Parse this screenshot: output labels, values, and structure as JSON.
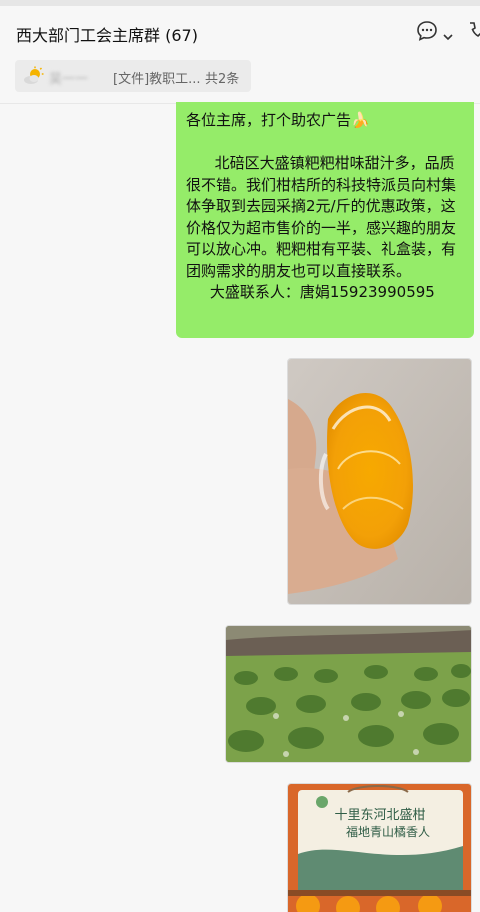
{
  "chat": {
    "title": "西大部门工会主席群 (67)"
  },
  "icons": {
    "chat_info": "chat-bubble-icon",
    "dropdown": "chevron-down-icon",
    "call": "phone-icon",
    "pinned": "sun-cloud-icon"
  },
  "pinned_notice": {
    "sender": "吴一一",
    "message": "[文件]教职工...",
    "count": "共2条"
  },
  "message_text": {
    "line1": "各位主席，打个助农广告🍌",
    "body": "\n      北碚区大盛镇粑粑柑味甜汁多，品质很不错。我们柑桔所的科技特派员向村集体争取到去园采摘2元/斤的优惠政策，这价格仅为超市售价的一半，感兴趣的朋友可以放心冲。粑粑柑有平装、礼盒装，有团购需求的朋友也可以直接联系。",
    "contact": "     大盛联系人：唐娟15923990595"
  },
  "box_print": {
    "line1": "十里东河北盛柑",
    "line2": "福地青山橘香人"
  },
  "colors": {
    "bubble": "#95ec69",
    "background": "#f7f7f7"
  }
}
